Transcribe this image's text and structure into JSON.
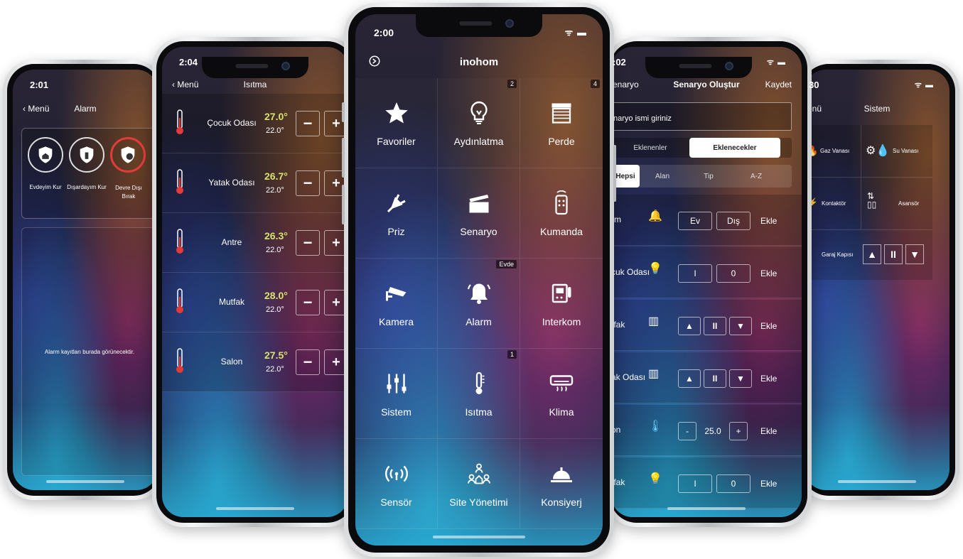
{
  "center": {
    "time": "2:00",
    "title": "inohom",
    "tiles": [
      {
        "label": "Favoriler",
        "icon": "star-icon",
        "badge": ""
      },
      {
        "label": "Aydınlatma",
        "icon": "lightbulb-icon",
        "badge": "2"
      },
      {
        "label": "Perde",
        "icon": "curtain-icon",
        "badge": "4"
      },
      {
        "label": "Priz",
        "icon": "plug-icon",
        "badge": ""
      },
      {
        "label": "Senaryo",
        "icon": "clapperboard-icon",
        "badge": ""
      },
      {
        "label": "Kumanda",
        "icon": "remote-icon",
        "badge": ""
      },
      {
        "label": "Kamera",
        "icon": "camera-icon",
        "badge": ""
      },
      {
        "label": "Alarm",
        "icon": "bell-icon",
        "badge": "Evde"
      },
      {
        "label": "Interkom",
        "icon": "intercom-icon",
        "badge": ""
      },
      {
        "label": "Sistem",
        "icon": "sliders-icon",
        "badge": ""
      },
      {
        "label": "Isıtma",
        "icon": "thermometer-icon",
        "badge": "1"
      },
      {
        "label": "Klima",
        "icon": "air-conditioner-icon",
        "badge": ""
      },
      {
        "label": "Sensör",
        "icon": "sensor-icon",
        "badge": ""
      },
      {
        "label": "Site Yönetimi",
        "icon": "community-icon",
        "badge": ""
      },
      {
        "label": "Konsiyerj",
        "icon": "concierge-bell-icon",
        "badge": ""
      }
    ]
  },
  "heating": {
    "time": "2:04",
    "back": "Menü",
    "title": "Isıtma",
    "rooms": [
      {
        "room": "Çocuk Odası",
        "current": "27.0°",
        "set": "22.0°"
      },
      {
        "room": "Yatak Odası",
        "current": "26.7°",
        "set": "22.0°"
      },
      {
        "room": "Antre",
        "current": "26.3°",
        "set": "22.0°"
      },
      {
        "room": "Mutfak",
        "current": "28.0°",
        "set": "22.0°"
      },
      {
        "room": "Salon",
        "current": "27.5°",
        "set": "22.0°"
      }
    ],
    "minus": "−",
    "plus": "+"
  },
  "alarm": {
    "time": "2:01",
    "back": "Menü",
    "title": "Alarm",
    "modes": [
      {
        "label": "Evdeyim Kur"
      },
      {
        "label": "Dışardayım Kur"
      },
      {
        "label": "Devre Dışı Bırak"
      }
    ],
    "empty_text": "Alarm kayıtları burada görünecektir."
  },
  "scenario": {
    "time": ":02",
    "back": "enaryo",
    "title": "Senaryo Oluştur",
    "save": "Kaydet",
    "name_placeholder": "naryo ismi giriniz",
    "tabs": [
      "Eklenenler",
      "Eklenecekler"
    ],
    "filters": [
      "Hepsi",
      "Alan",
      "Tip",
      "A-Z"
    ],
    "rows": [
      {
        "name": "rm",
        "a": "Ev",
        "b": "Dış",
        "add": "Ekle"
      },
      {
        "name": "cuk Odası",
        "a": "I",
        "b": "0",
        "add": "Ekle"
      },
      {
        "name": "tfak",
        "a": "▲",
        "b": "II",
        "c": "▼",
        "add": "Ekle"
      },
      {
        "name": "ak Odası",
        "a": "▲",
        "b": "II",
        "c": "▼",
        "add": "Ekle"
      },
      {
        "name": "on",
        "a": "-",
        "b": "25.0",
        "c": "+",
        "add": "Ekle"
      },
      {
        "name": "tfak",
        "a": "I",
        "b": "0",
        "add": "Ekle"
      }
    ]
  },
  "system": {
    "time": "30",
    "back": "enü",
    "title": "Sistem",
    "items": [
      {
        "label": "Gaz Vanası"
      },
      {
        "label": "Su Vanası"
      },
      {
        "label": "Kontaktör"
      },
      {
        "label": "Asansör"
      },
      {
        "label": "Garaj Kapısı"
      }
    ],
    "garage_controls": [
      "▲",
      "II",
      "▼"
    ]
  }
}
